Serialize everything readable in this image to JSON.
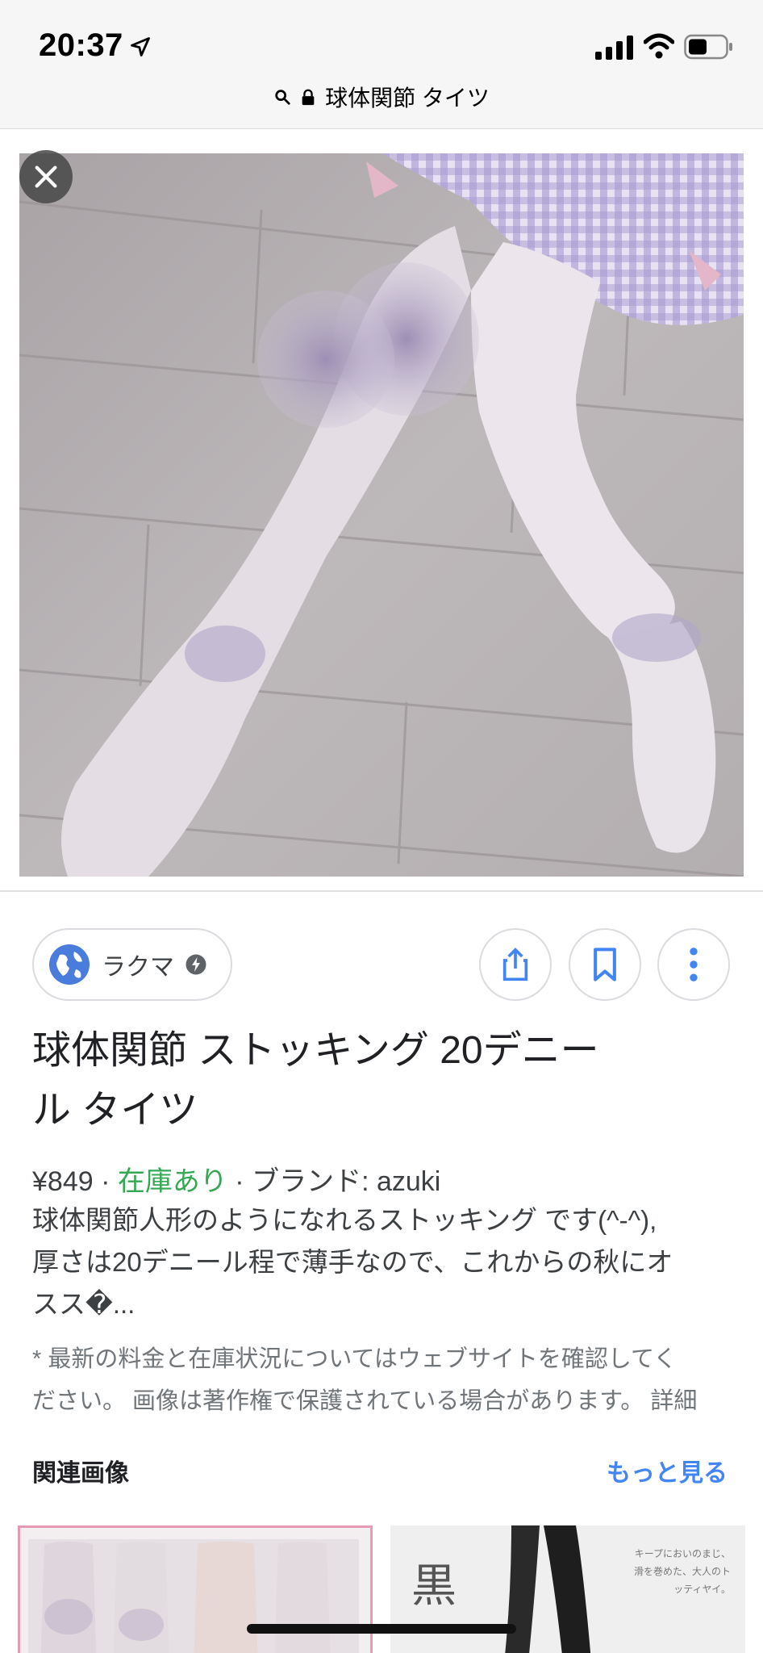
{
  "status_bar": {
    "time": "20:37",
    "url_text": "球体関節 タイツ",
    "icons": [
      "location-arrow-icon",
      "signal-icon",
      "wifi-icon",
      "battery-icon",
      "search-icon",
      "lock-icon"
    ]
  },
  "viewer": {
    "close_icon": "close-icon",
    "image_alt": "stocking legs photo"
  },
  "source": {
    "name": "ラクマ",
    "icons": [
      "globe-icon",
      "bolt-icon",
      "share-icon",
      "bookmark-icon",
      "more-vert-icon"
    ]
  },
  "product": {
    "title_line1": "球体関節 ストッキング 20デニー",
    "title_line2": "ル タイツ",
    "price": "¥849",
    "sep1": " · ",
    "stock": "在庫あり",
    "sep2": " · ",
    "brand": "ブランド: azuki",
    "desc_line1": "球体関節人形のようになれるストッキング です(^-^),",
    "desc_line2": "厚さは20デニール程で薄手なので、これからの秋にオ",
    "desc_line3": "スス�...",
    "note_line1": "* 最新の料金と在庫状況についてはウェブサイトを確認してく",
    "note_line2": "ださい。 画像は著作権で保護されている場合があります。 詳細"
  },
  "related": {
    "header": "関連画像",
    "more_label": "もっと見る",
    "thumb2_char": "黒",
    "thumb2_text": "キープにおいのまじ、滑を巻めた、大人のトッティヤイ。"
  },
  "colors": {
    "accent_link": "#4285f4",
    "stock_green": "#34a853",
    "selected_thumb_border": "#e899b6"
  }
}
